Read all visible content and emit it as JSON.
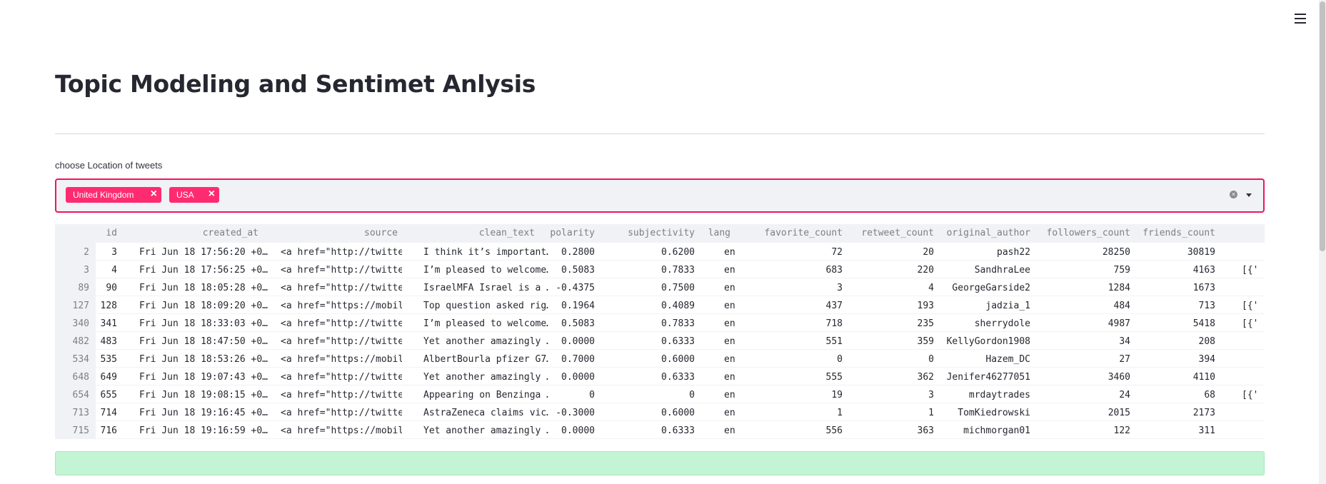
{
  "page": {
    "title": "Topic Modeling and Sentimet Anlysis",
    "menu_icon": "hamburger-menu-icon"
  },
  "filter": {
    "label": "choose Location of tweets",
    "selected": [
      "United Kingdom",
      "USA"
    ],
    "remove_icon": "close-icon",
    "clear_icon": "clear-all-icon",
    "dropdown_icon": "chevron-down-icon",
    "accent_color": "#ff2b70"
  },
  "table": {
    "columns": [
      "",
      "id",
      "created_at",
      "source",
      "clean_text",
      "polarity",
      "subjectivity",
      "lang",
      "favorite_count",
      "retweet_count",
      "original_author",
      "followers_count",
      "friends_count",
      ""
    ],
    "rows": [
      [
        "2",
        "3",
        "Fri Jun 18 17:56:20 +0…",
        "<a href=\"http://twitte…",
        "I think it’s important…",
        "0.2800",
        "0.6200",
        "en",
        "72",
        "20",
        "pash22",
        "28250",
        "30819",
        ""
      ],
      [
        "3",
        "4",
        "Fri Jun 18 17:56:25 +0…",
        "<a href=\"http://twitte…",
        "I’m pleased to welcome…",
        "0.5083",
        "0.7833",
        "en",
        "683",
        "220",
        "SandhraLee",
        "759",
        "4163",
        "[{'"
      ],
      [
        "89",
        "90",
        "Fri Jun 18 18:05:28 +0…",
        "<a href=\"http://twitte…",
        "IsraelMFA Israel is a …",
        "-0.4375",
        "0.7500",
        "en",
        "3",
        "4",
        "GeorgeGarside2",
        "1284",
        "1673",
        ""
      ],
      [
        "127",
        "128",
        "Fri Jun 18 18:09:20 +0…",
        "<a href=\"https://mobil…",
        "Top question asked rig…",
        "0.1964",
        "0.4089",
        "en",
        "437",
        "193",
        "jadzia_1",
        "484",
        "713",
        "[{'"
      ],
      [
        "340",
        "341",
        "Fri Jun 18 18:33:03 +0…",
        "<a href=\"http://twitte…",
        "I’m pleased to welcome…",
        "0.5083",
        "0.7833",
        "en",
        "718",
        "235",
        "sherrydole",
        "4987",
        "5418",
        "[{'"
      ],
      [
        "482",
        "483",
        "Fri Jun 18 18:47:50 +0…",
        "<a href=\"http://twitte…",
        "Yet another amazingly …",
        "0.0000",
        "0.6333",
        "en",
        "551",
        "359",
        "KellyGordon1908",
        "34",
        "208",
        ""
      ],
      [
        "534",
        "535",
        "Fri Jun 18 18:53:26 +0…",
        "<a href=\"https://mobil…",
        "AlbertBourla pfizer G7…",
        "0.7000",
        "0.6000",
        "en",
        "0",
        "0",
        "Hazem_DC",
        "27",
        "394",
        ""
      ],
      [
        "648",
        "649",
        "Fri Jun 18 19:07:43 +0…",
        "<a href=\"http://twitte…",
        "Yet another amazingly …",
        "0.0000",
        "0.6333",
        "en",
        "555",
        "362",
        "Jenifer46277051",
        "3460",
        "4110",
        ""
      ],
      [
        "654",
        "655",
        "Fri Jun 18 19:08:15 +0…",
        "<a href=\"http://twitte…",
        "Appearing on Benzinga …",
        "0",
        "0",
        "en",
        "19",
        "3",
        "mrdaytrades",
        "24",
        "68",
        "[{'"
      ],
      [
        "713",
        "714",
        "Fri Jun 18 19:16:45 +0…",
        "<a href=\"http://twitte…",
        "AstraZeneca claims vic…",
        "-0.3000",
        "0.6000",
        "en",
        "1",
        "1",
        "TomKiedrowski",
        "2015",
        "2173",
        ""
      ],
      [
        "715",
        "716",
        "Fri Jun 18 19:16:59 +0…",
        "<a href=\"https://mobil…",
        "Yet another amazingly …",
        "0.0000",
        "0.6333",
        "en",
        "556",
        "363",
        "michmorgan01",
        "122",
        "311",
        ""
      ]
    ]
  },
  "status": {
    "success_color": "#c3f4d4"
  }
}
